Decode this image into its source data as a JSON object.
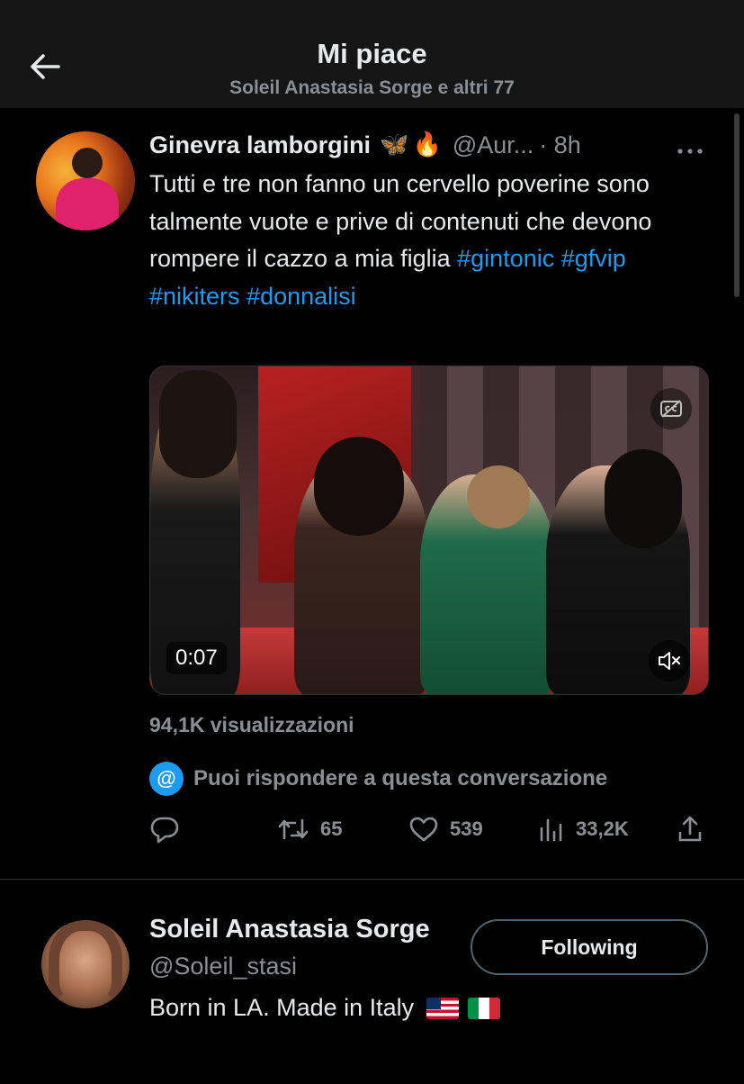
{
  "header": {
    "title": "Mi piace",
    "subtitle": "Soleil Anastasia Sorge e altri 77"
  },
  "tweet": {
    "author_name": "Ginevra lamborgini",
    "emojis": [
      "🦋",
      "🔥"
    ],
    "handle": "@Aur...",
    "time": "· 8h",
    "text_plain": "Tutti e tre non fanno un cervello poverine sono talmente vuote e prive di contenuti che devono rompere il cazzo a mia figlia ",
    "hashtags": [
      "#gintonic",
      "#gfvip",
      "#nikiters",
      "#donnalisi"
    ],
    "media": {
      "duration": "0:07",
      "muted": true
    },
    "views": "94,1K visualizzazioni",
    "reply_info": "Puoi rispondere a questa conversazione",
    "reply_badge": "@",
    "stats": {
      "retweets": "65",
      "likes": "539",
      "views": "33,2K"
    }
  },
  "liker": {
    "name": "Soleil Anastasia Sorge",
    "handle": "@Soleil_stasi",
    "follow_label": "Following",
    "bio": "Born in LA. Made in Italy"
  },
  "icons": {
    "back": "arrow-left-icon",
    "more": "more-horizontal-icon",
    "reply": "reply-icon",
    "retweet": "retweet-icon",
    "like": "heart-icon",
    "views": "bar-chart-icon",
    "share": "share-icon",
    "captions": "closed-captions-icon",
    "mute": "volume-muted-icon"
  },
  "colors": {
    "background": "#000000",
    "header_bg": "#151515",
    "accent": "#1d9bf0",
    "text": "#e7e9ea",
    "muted_text": "#8b8f94"
  }
}
